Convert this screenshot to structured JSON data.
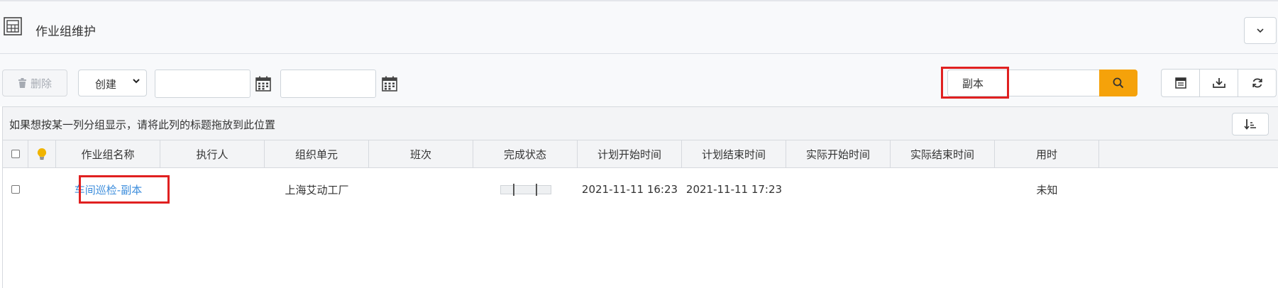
{
  "header": {
    "title": "作业组维护",
    "icons": {
      "page": "report-grid-icon",
      "collapse": "chevron-down-icon"
    }
  },
  "toolbar": {
    "delete_label": "删除",
    "create_label": "创建",
    "date_start_value": "",
    "date_end_value": "",
    "search_value": "副本",
    "icons": [
      "trash-icon",
      "calendar-icon",
      "search-icon",
      "column-chooser-icon",
      "export-icon",
      "refresh-icon"
    ]
  },
  "grid": {
    "group_hint": "如果想按某一列分组显示，请将此列的标题拖放到此位置",
    "columns": [
      "作业组名称",
      "执行人",
      "组织单元",
      "班次",
      "完成状态",
      "计划开始时间",
      "计划结束时间",
      "实际开始时间",
      "实际结束时间",
      "用时"
    ],
    "rows": [
      {
        "name": "车间巡检-副本",
        "executor": "",
        "org_unit": "上海艾动工厂",
        "shift": "",
        "completion": 0,
        "plan_start": "2021-11-11 16:23",
        "plan_end": "2021-11-11 17:23",
        "actual_start": "",
        "actual_end": "",
        "duration": "未知"
      }
    ]
  },
  "colors": {
    "accent": "#f5a20a",
    "link": "#3c8ddc",
    "highlight": "#e02020"
  }
}
